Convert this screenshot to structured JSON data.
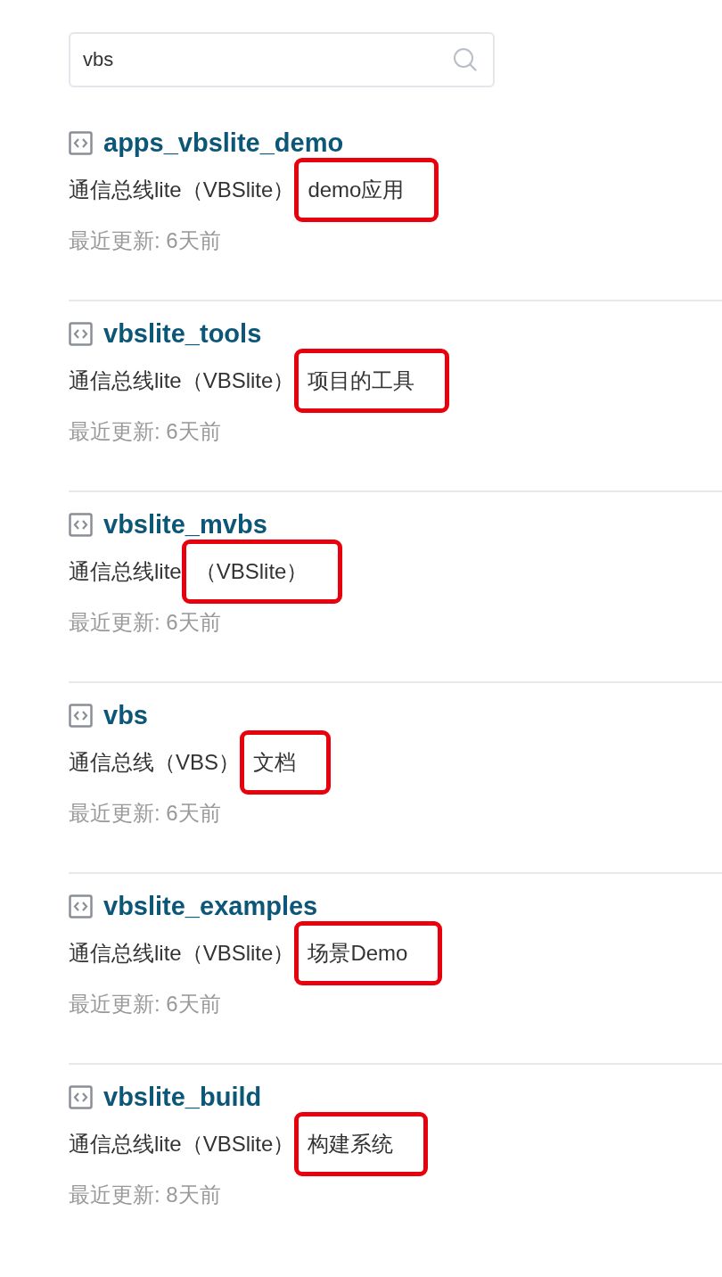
{
  "search": {
    "value": "vbs"
  },
  "results": [
    {
      "title": "apps_vbslite_demo",
      "description": "通信总线lite（VBSlite）",
      "highlight": "demo应用",
      "updated": "最近更新: 6天前"
    },
    {
      "title": "vbslite_tools",
      "description": "通信总线lite（VBSlite）",
      "highlight": "项目的工具",
      "updated": "最近更新: 6天前"
    },
    {
      "title": "vbslite_mvbs",
      "description": "通信总线lite",
      "highlight": "（VBSlite）",
      "updated": "最近更新: 6天前"
    },
    {
      "title": "vbs",
      "description": "通信总线（VBS）",
      "highlight": "文档",
      "updated": "最近更新: 6天前"
    },
    {
      "title": "vbslite_examples",
      "description": "通信总线lite（VBSlite）",
      "highlight": "场景Demo",
      "updated": "最近更新: 6天前"
    },
    {
      "title": "vbslite_build",
      "description": "通信总线lite（VBSlite）",
      "highlight": "构建系统",
      "updated": "最近更新: 8天前"
    }
  ]
}
